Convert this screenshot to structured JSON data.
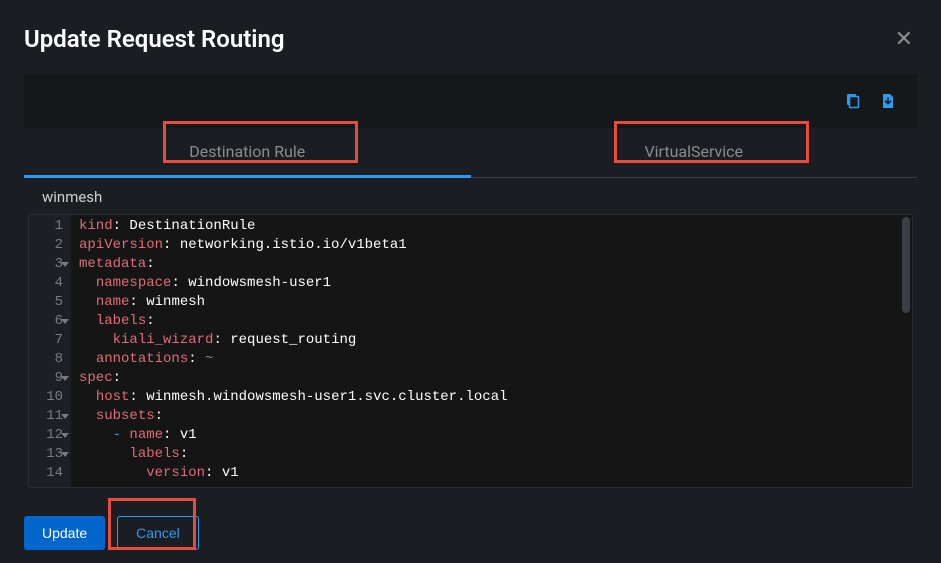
{
  "modal": {
    "title": "Update Request Routing"
  },
  "tabs": {
    "destRule": "Destination Rule",
    "virtualService": "VirtualService"
  },
  "resourceName": "winmesh",
  "code": {
    "lines": [
      {
        "n": 1,
        "fold": false,
        "tokens": [
          [
            "key",
            "kind"
          ],
          [
            "punct",
            ": "
          ],
          [
            "str",
            "DestinationRule"
          ]
        ]
      },
      {
        "n": 2,
        "fold": false,
        "tokens": [
          [
            "key",
            "apiVersion"
          ],
          [
            "punct",
            ": "
          ],
          [
            "str",
            "networking.istio.io/v1beta1"
          ]
        ]
      },
      {
        "n": 3,
        "fold": true,
        "tokens": [
          [
            "key",
            "metadata"
          ],
          [
            "punct",
            ":"
          ]
        ]
      },
      {
        "n": 4,
        "fold": false,
        "tokens": [
          [
            "str",
            "  "
          ],
          [
            "key",
            "namespace"
          ],
          [
            "punct",
            ": "
          ],
          [
            "str",
            "windowsmesh-user1"
          ]
        ]
      },
      {
        "n": 5,
        "fold": false,
        "tokens": [
          [
            "str",
            "  "
          ],
          [
            "key",
            "name"
          ],
          [
            "punct",
            ": "
          ],
          [
            "str",
            "winmesh"
          ]
        ]
      },
      {
        "n": 6,
        "fold": true,
        "tokens": [
          [
            "str",
            "  "
          ],
          [
            "key",
            "labels"
          ],
          [
            "punct",
            ":"
          ]
        ]
      },
      {
        "n": 7,
        "fold": false,
        "tokens": [
          [
            "str",
            "    "
          ],
          [
            "key",
            "kiali_wizard"
          ],
          [
            "punct",
            ": "
          ],
          [
            "str",
            "request_routing"
          ]
        ]
      },
      {
        "n": 8,
        "fold": false,
        "tokens": [
          [
            "str",
            "  "
          ],
          [
            "key",
            "annotations"
          ],
          [
            "punct",
            ": "
          ],
          [
            "tilde",
            "~"
          ]
        ]
      },
      {
        "n": 9,
        "fold": true,
        "tokens": [
          [
            "key",
            "spec"
          ],
          [
            "punct",
            ":"
          ]
        ]
      },
      {
        "n": 10,
        "fold": false,
        "tokens": [
          [
            "str",
            "  "
          ],
          [
            "key",
            "host"
          ],
          [
            "punct",
            ": "
          ],
          [
            "str",
            "winmesh.windowsmesh-user1.svc.cluster.local"
          ]
        ]
      },
      {
        "n": 11,
        "fold": true,
        "tokens": [
          [
            "str",
            "  "
          ],
          [
            "key",
            "subsets"
          ],
          [
            "punct",
            ":"
          ]
        ]
      },
      {
        "n": 12,
        "fold": true,
        "tokens": [
          [
            "str",
            "    "
          ],
          [
            "bullet",
            "- "
          ],
          [
            "key",
            "name"
          ],
          [
            "punct",
            ": "
          ],
          [
            "str",
            "v1"
          ]
        ]
      },
      {
        "n": 13,
        "fold": true,
        "tokens": [
          [
            "str",
            "      "
          ],
          [
            "key",
            "labels"
          ],
          [
            "punct",
            ":"
          ]
        ]
      },
      {
        "n": 14,
        "fold": false,
        "tokens": [
          [
            "str",
            "        "
          ],
          [
            "key",
            "version"
          ],
          [
            "punct",
            ": "
          ],
          [
            "str",
            "v1"
          ]
        ]
      }
    ]
  },
  "footer": {
    "update": "Update",
    "cancel": "Cancel"
  }
}
